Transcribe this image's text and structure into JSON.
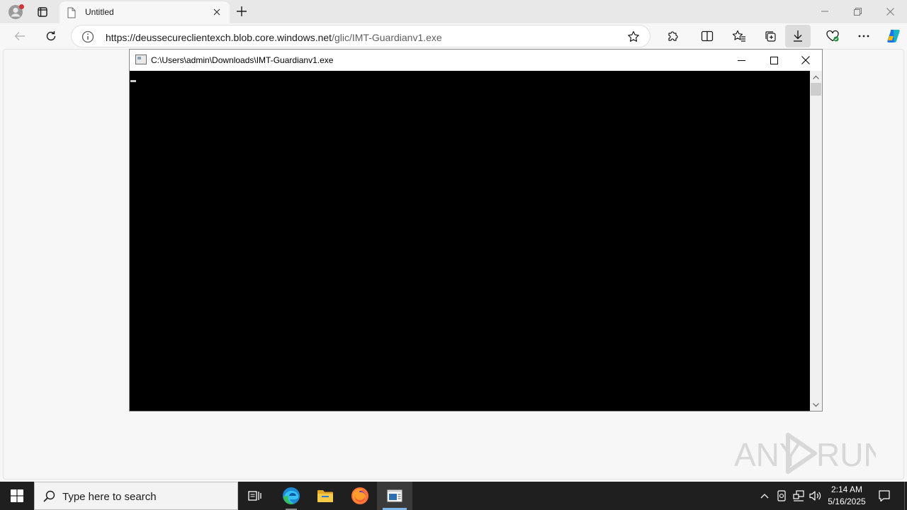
{
  "browser": {
    "tab_title": "Untitled",
    "url_host": "https://deussecureclientexch.blob.core.windows.net",
    "url_path": "/glic/IMT-Guardianv1.exe",
    "icons": {
      "profile": "profile-icon",
      "tab_actions": "tab-actions-icon",
      "new_tab": "plus-icon",
      "back": "back-arrow-icon",
      "reload": "reload-icon",
      "site_info": "info-icon",
      "favorite": "star-icon",
      "extensions": "puzzle-icon",
      "split": "split-screen-icon",
      "favorites": "favorites-icon",
      "collections": "collections-icon",
      "downloads": "download-icon",
      "performance": "performance-icon",
      "more": "more-icon",
      "copilot": "copilot-icon"
    }
  },
  "console": {
    "title": "C:\\Users\\admin\\Downloads\\IMT-Guardianv1.exe"
  },
  "watermark": {
    "left_text": "ANY",
    "right_text": "RUN"
  },
  "taskbar": {
    "search_placeholder": "Type here to search",
    "clock_time": "2:14 AM",
    "clock_date": "5/16/2025"
  },
  "colors": {
    "console_bg": "#000000",
    "taskbar_bg": "#1f1f1f",
    "accent": "#0078d4"
  }
}
